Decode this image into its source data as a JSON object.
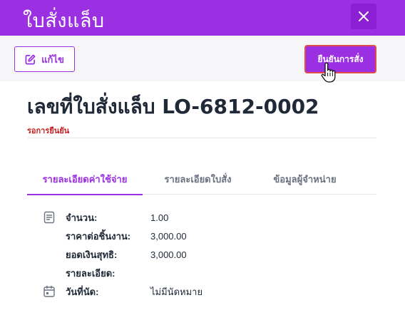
{
  "header": {
    "title": "ใบสั่งแล็บ",
    "close_icon": "close-icon"
  },
  "toolbar": {
    "edit_label": "แก้ไข",
    "confirm_label": "ยืนยันการสั่ง"
  },
  "document": {
    "title": "เลขที่ใบสั่งแล็บ LO-6812-0002",
    "status": "รอการยืนยัน",
    "status_color": "#c81e1e"
  },
  "tabs": [
    {
      "label": "รายละเอียดค่าใช้จ่าย",
      "active": true
    },
    {
      "label": "รายละเอียดใบสั่ง",
      "active": false
    },
    {
      "label": "ข้อมูลผู้จำหน่าย",
      "active": false
    }
  ],
  "details": [
    {
      "label": "จำนวน:",
      "value": "1.00",
      "icon": "document-list-icon"
    },
    {
      "label": "ราคาต่อชิ้นงาน:",
      "value": "3,000.00"
    },
    {
      "label": "ยอดเงินสุทธิ:",
      "value": "3,000.00"
    },
    {
      "label": "รายละเอียด:",
      "value": ""
    },
    {
      "label": "วันที่นัด:",
      "value": "ไม่มีนัดหมาย",
      "icon": "calendar-icon"
    }
  ],
  "colors": {
    "accent": "#9b30e3",
    "accent_dark": "#8a1fd4",
    "danger_border": "#e24b4b"
  }
}
